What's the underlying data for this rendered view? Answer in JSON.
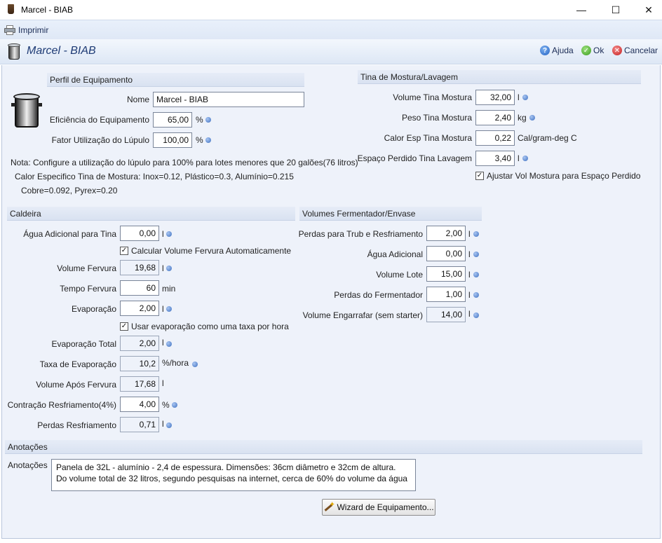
{
  "window": {
    "title": "Marcel - BIAB",
    "min": "—",
    "max": "☐",
    "close": "✕"
  },
  "menu": {
    "print": "Imprimir"
  },
  "header": {
    "title": "Marcel - BIAB",
    "help": "Ajuda",
    "ok": "Ok",
    "cancel": "Cancelar"
  },
  "profile": {
    "section": "Perfil de Equipamento",
    "name_label": "Nome",
    "name_value": "Marcel - BIAB",
    "efficiency_label": "Eficiência do Equipamento",
    "efficiency_value": "65,00",
    "efficiency_unit": "%",
    "hop_label": "Fator Utilização do Lúpulo",
    "hop_value": "100,00",
    "hop_unit": "%",
    "note1": "Nota: Configure a utilização do lúpulo para 100% para lotes menores que 20 galões(76 litros)",
    "note2": "Calor Especifico Tina de Mostura: Inox=0.12, Plástico=0.3, Alumínio=0.215",
    "note3": "Cobre=0.092, Pyrex=0.20"
  },
  "mash": {
    "section": "Tina de Mostura/Lavagem",
    "vol_label": "Volume Tina Mostura",
    "vol_value": "32,00",
    "vol_unit": "l",
    "weight_label": "Peso Tina Mostura",
    "weight_value": "2,40",
    "weight_unit": "kg",
    "heat_label": "Calor Esp Tina Mostura",
    "heat_value": "0,22",
    "heat_unit": "Cal/gram-deg C",
    "dead_label": "Espaço Perdido Tina Lavagem",
    "dead_value": "3,40",
    "dead_unit": "l",
    "adjust_label": "Ajustar Vol Mostura para Espaço Perdido",
    "adjust_check": "✓"
  },
  "boil": {
    "section": "Caldeira",
    "addwater_label": "Água Adicional para Tina",
    "addwater_value": "0,00",
    "addwater_unit": "l",
    "autocalc_label": "Calcular Volume Fervura Automaticamente",
    "autocalc_check": "✓",
    "boilvol_label": "Volume Fervura",
    "boilvol_value": "19,68",
    "boilvol_unit": "l",
    "boiltime_label": "Tempo Fervura",
    "boiltime_value": "60",
    "boiltime_unit": "min",
    "evap_label": "Evaporação",
    "evap_value": "2,00",
    "evap_unit": "l",
    "rate_check_label": "Usar evaporação como uma taxa por hora",
    "rate_check": "✓",
    "evaptotal_label": "Evaporação Total",
    "evaptotal_value": "2,00",
    "evaptotal_unit": "l",
    "evaprate_label": "Taxa de Evaporação",
    "evaprate_value": "10,2",
    "evaprate_unit": "%/hora",
    "postboil_label": "Volume Após Fervura",
    "postboil_value": "17,68",
    "postboil_unit": "l",
    "shrink_label": "Contração Resfriamento(4%)",
    "shrink_value": "4,00",
    "shrink_unit": "%",
    "coolloss_label": "Perdas Resfriamento",
    "coolloss_value": "0,71",
    "coolloss_unit": "l"
  },
  "ferm": {
    "section": "Volumes Fermentador/Envase",
    "trub_label": "Perdas para Trub e Resfriamento",
    "trub_value": "2,00",
    "trub_unit": "l",
    "topup_label": "Água Adicional",
    "topup_value": "0,00",
    "topup_unit": "l",
    "batch_label": "Volume Lote",
    "batch_value": "15,00",
    "batch_unit": "l",
    "fermloss_label": "Perdas do Fermentador",
    "fermloss_value": "1,00",
    "fermloss_unit": "l",
    "bottle_label": "Volume Engarrafar (sem starter)",
    "bottle_value": "14,00",
    "bottle_unit": "l"
  },
  "notes": {
    "section": "Anotações",
    "label": "Anotações",
    "line1": "Panela de 32L - alumínio - 2,4 de espessura. Dimensões: 36cm diâmetro e 32cm de altura.",
    "line2": "Do volume total de 32 litros, segundo pesquisas na internet, cerca de 60% do volume da água"
  },
  "wizard": {
    "label": "Wizard de Equipamento..."
  }
}
